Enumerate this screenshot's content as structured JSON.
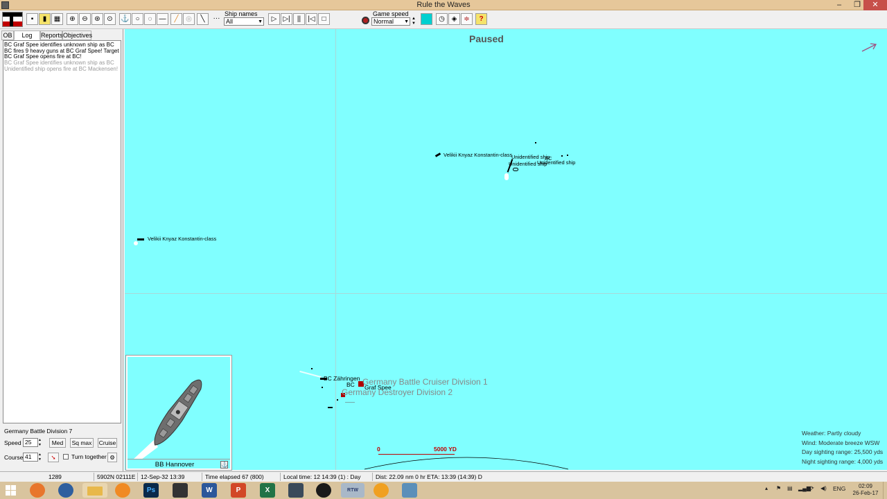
{
  "window": {
    "title": "Rule the Waves"
  },
  "toolbar": {
    "ship_names_label": "Ship names",
    "ship_names_value": "All",
    "game_speed_label": "Game speed",
    "game_speed_value": "Normal"
  },
  "tabs": [
    "OB",
    "Log",
    "Reports",
    "Objectives"
  ],
  "log": [
    "BC Graf Spee identifies unknown ship as BC",
    "BC fires 9 heavy guns at BC Graf Spee! Target straddled",
    "BC Graf Spee opens fire at BC!",
    "BC Graf Spee identifies unknown ship as BC",
    "Unidentified ship opens fire at BC Mackensen!"
  ],
  "controls": {
    "division": "Germany Battle Division 7",
    "speed_label": "Speed",
    "speed_value": "25",
    "med_label": "Med",
    "sqmax_label": "Sq max",
    "cruise_label": "Cruise",
    "course_label": "Course",
    "course_value": "41",
    "turn_together_label": "Turn together"
  },
  "map": {
    "status": "Paused",
    "labels": {
      "vk_a": "Velikii Knyaz Konstantin-class",
      "vk_b": "Velikii Knyaz Konstantin-class",
      "unid_1": "Unidentified ship",
      "unid_2": "Unidentified ship",
      "unid_3": "Unidentified ship",
      "bc": "BC",
      "zahringen": "BC Zähringen",
      "bc2": "BC",
      "graf_spee": "Graf Spee",
      "div1": "Germany Battle Cruiser Division 1",
      "div2": "Germany Destroyer Division 2"
    },
    "scale_zero": "0",
    "scale_label": "5000 YD",
    "weather": [
      "Weather: Partly cloudy",
      "Wind: Moderate breeze  WSW",
      "Day sighting range: 25,500 yds",
      "Night sighting range: 4,000 yds"
    ],
    "selected_ship": "BB Hannover"
  },
  "status_bar": {
    "turn": "1289",
    "position": "5902N 02111E",
    "date": "12-Sep-32 13:39",
    "elapsed": "Time elapsed 67 (800)",
    "local_time": "Local time: 12 14:39 (1) : Day",
    "dist": "Dist: 22.09 nm 0 hr ETA: 13:39 (14:39) D"
  },
  "taskbar": {
    "language": "ENG",
    "time": "02:09",
    "date": "26-Feb-17",
    "apps": [
      "Firefox",
      "Thunderbird",
      "File Explorer",
      "Blender",
      "Photoshop",
      "Inkscape",
      "Word",
      "PowerPoint",
      "Excel",
      "World of Warships",
      "Steam",
      "RTW",
      "Avast",
      "Notepad"
    ],
    "app_glyphs": [
      "",
      "",
      "",
      "",
      "Ps",
      "",
      "W",
      "P",
      "X",
      "",
      "",
      "RTW",
      "",
      ""
    ]
  },
  "colors": {
    "sea": "#80ffff",
    "titlebar": "#e6c79a",
    "taskbar": "#d9c49e",
    "scale_red": "#c00000"
  }
}
